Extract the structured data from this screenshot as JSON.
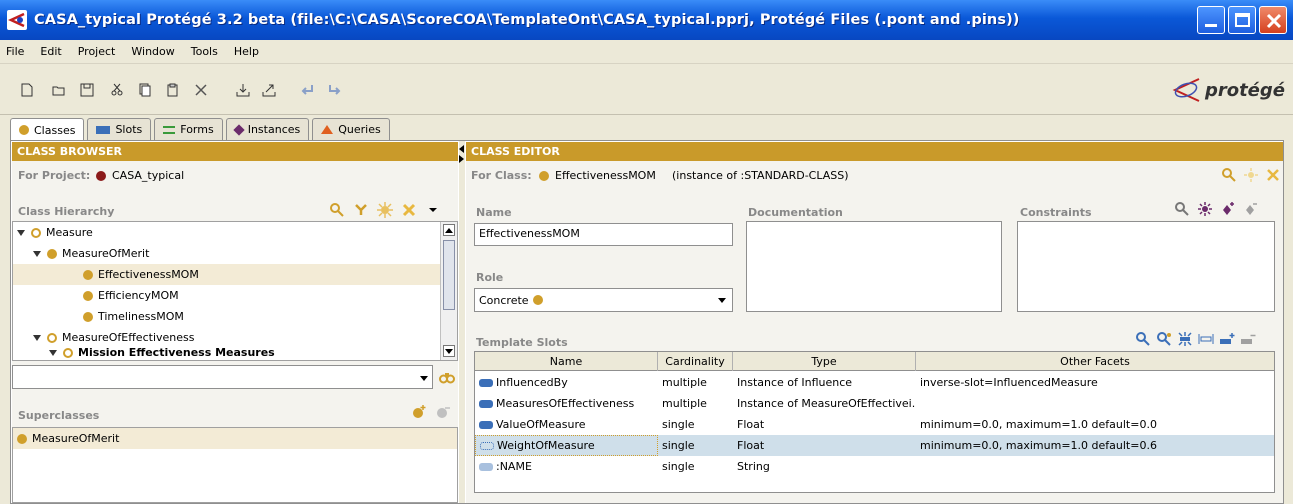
{
  "window": {
    "title": "CASA_typical  Protégé 3.2 beta    (file:\\C:\\CASA\\ScoreCOA\\TemplateOnt\\CASA_typical.pprj, Protégé Files (.pont and .pins))"
  },
  "menu": [
    "File",
    "Edit",
    "Project",
    "Window",
    "Tools",
    "Help"
  ],
  "logo": "protégé",
  "tabs": [
    {
      "label": "Classes",
      "icon": "class-dot-icon",
      "color": "#d09f2b"
    },
    {
      "label": "Slots",
      "icon": "slot-bar-icon",
      "color": "#3b6fb8"
    },
    {
      "label": "Forms",
      "icon": "form-lines-icon",
      "color": "#3a9a3a"
    },
    {
      "label": "Instances",
      "icon": "instance-diamond-icon",
      "color": "#6b2b6b"
    },
    {
      "label": "Queries",
      "icon": "query-triangle-icon",
      "color": "#e06020"
    }
  ],
  "class_browser": {
    "header": "CLASS BROWSER",
    "project_label": "For Project:",
    "project_name": "CASA_typical",
    "hierarchy_label": "Class Hierarchy",
    "tree": [
      {
        "label": "Measure",
        "level": 0,
        "expanded": true,
        "selected": false
      },
      {
        "label": "MeasureOfMerit",
        "level": 1,
        "expanded": true,
        "selected": false
      },
      {
        "label": "EffectivenessMOM",
        "level": 2,
        "expanded": false,
        "selected": true
      },
      {
        "label": "EfficiencyMOM",
        "level": 2,
        "expanded": false,
        "selected": false
      },
      {
        "label": "TimelinessMOM",
        "level": 2,
        "expanded": false,
        "selected": false
      },
      {
        "label": "MeasureOfEffectiveness",
        "level": 1,
        "expanded": true,
        "selected": false
      },
      {
        "label": "Mission Effectiveness Measures",
        "level": 2,
        "expanded": true,
        "selected": false
      }
    ],
    "search_value": "",
    "superclasses_label": "Superclasses",
    "superclasses": [
      "MeasureOfMerit"
    ]
  },
  "class_editor": {
    "header": "CLASS EDITOR",
    "for_class_label": "For Class:",
    "class_name": "EffectivenessMOM",
    "instance_of": "(instance of :STANDARD-CLASS)",
    "name_label": "Name",
    "name_value": "EffectivenessMOM",
    "documentation_label": "Documentation",
    "constraints_label": "Constraints",
    "role_label": "Role",
    "role_value": "Concrete",
    "template_slots_label": "Template Slots",
    "columns": [
      "Name",
      "Cardinality",
      "Type",
      "Other Facets"
    ],
    "slots": [
      {
        "name": "InfluencedBy",
        "cardinality": "multiple",
        "type": "Instance of Influence",
        "facets": "inverse-slot=InfluencedMeasure",
        "icon": "solid",
        "selected": false
      },
      {
        "name": "MeasuresOfEffectiveness",
        "cardinality": "multiple",
        "type": "Instance of MeasureOfEffectivei...",
        "facets": "",
        "icon": "solid",
        "selected": false
      },
      {
        "name": "ValueOfMeasure",
        "cardinality": "single",
        "type": "Float",
        "facets": "minimum=0.0, maximum=1.0 default=0.0",
        "icon": "solid",
        "selected": false
      },
      {
        "name": "WeightOfMeasure",
        "cardinality": "single",
        "type": "Float",
        "facets": "minimum=0.0, maximum=1.0 default=0.6",
        "icon": "outline",
        "selected": true
      },
      {
        "name": ":NAME",
        "cardinality": "single",
        "type": "String",
        "facets": "",
        "icon": "light",
        "selected": false
      }
    ]
  }
}
